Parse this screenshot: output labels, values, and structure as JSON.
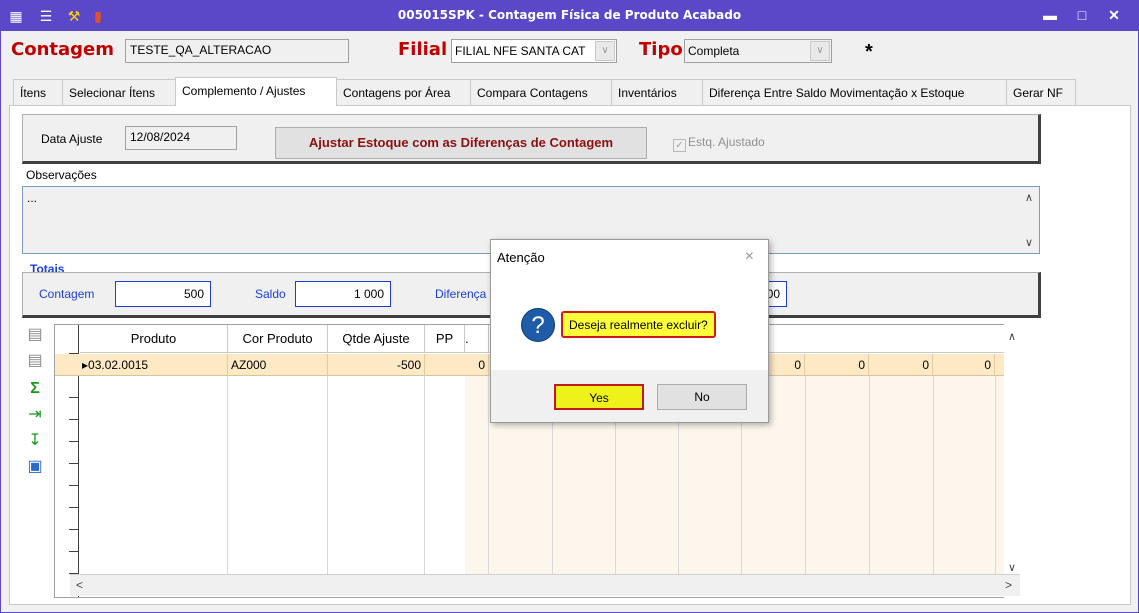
{
  "window": {
    "title": "005015SPK - Contagem Física de Produto Acabado",
    "icons": [
      "menu-icon",
      "tree-icon",
      "wrench-icon",
      "book-icon"
    ],
    "controls": [
      "minimize-icon",
      "maximize-icon",
      "close-icon"
    ]
  },
  "header": {
    "contagem_label": "Contagem",
    "contagem_value": "TESTE_QA_ALTERACAO",
    "filial_label": "Filial",
    "filial_value": "FILIAL NFE SANTA CAT",
    "tipo_label": "Tipo",
    "tipo_value": "Completa",
    "star": "*"
  },
  "tabs": [
    {
      "label": "Ítens"
    },
    {
      "label": "Selecionar Ítens"
    },
    {
      "label": "Complemento / Ajustes"
    },
    {
      "label": "Contagens por Área"
    },
    {
      "label": "Compara Contagens"
    },
    {
      "label": "Inventários"
    },
    {
      "label": "Diferença Entre Saldo Movimentação x Estoque"
    },
    {
      "label": "Gerar NF"
    }
  ],
  "ajuste": {
    "data_label": "Data Ajuste",
    "data_value": "12/08/2024",
    "button_label": "Ajustar Estoque com as Diferenças de Contagem",
    "checkbox_label": "Estq. Ajustado",
    "checkbox_checked": true
  },
  "observacoes": {
    "label": "Observações",
    "value": "..."
  },
  "totais": {
    "title": "Totais",
    "contagem_label": "Contagem",
    "contagem_value": "500",
    "saldo_label": "Saldo",
    "saldo_value": "1 000",
    "diferenca_label": "Diferença",
    "diferenca_value": "00"
  },
  "grid": {
    "columns": [
      "Produto",
      "Cor Produto",
      "Qtde Ajuste",
      "PP",
      "."
    ],
    "row": {
      "produto": "03.02.0015",
      "cor": "AZ000",
      "qtde": "-500",
      "pp": "0",
      "right_values": [
        "0",
        "0",
        "0",
        "0",
        "0"
      ]
    }
  },
  "dialog": {
    "title": "Atenção",
    "close": "×",
    "message": "Deseja realmente excluir?",
    "icon": "?",
    "yes": "Yes",
    "no": "No"
  }
}
